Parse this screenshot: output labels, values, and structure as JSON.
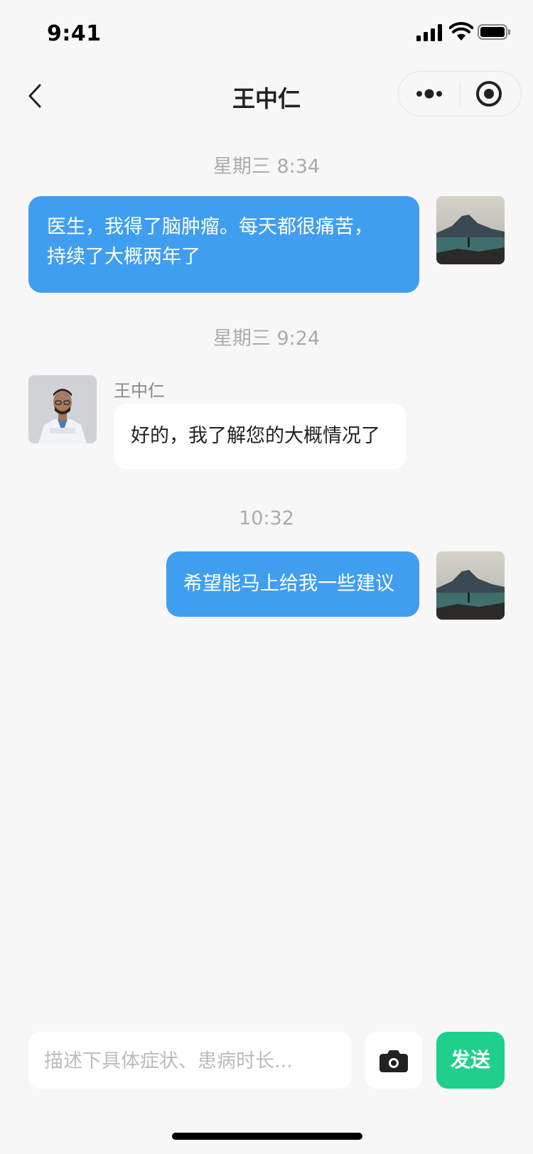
{
  "status_bar": {
    "time": "9:41"
  },
  "nav": {
    "title": "王中仁"
  },
  "messages": [
    {
      "time": "星期三 8:34",
      "text_line1": "医生，我得了脑肿瘤。每天都很痛苦，",
      "text_line2": "持续了大概两年了"
    },
    {
      "time": "星期三 9:24",
      "sender": "王中仁",
      "text": "好的，我了解您的大概情况了"
    },
    {
      "time": "10:32",
      "text": "希望能马上给我一些建议"
    }
  ],
  "input": {
    "placeholder": "描述下具体症状、患病时长..."
  },
  "send_label": "发送",
  "colors": {
    "accent_blue": "#409ef0",
    "send_green": "#1fcf8c",
    "background": "#f7f7f7"
  },
  "icons": {
    "back": "chevron-left-icon",
    "more": "more-dots-icon",
    "close": "target-circle-icon",
    "camera": "camera-icon"
  }
}
